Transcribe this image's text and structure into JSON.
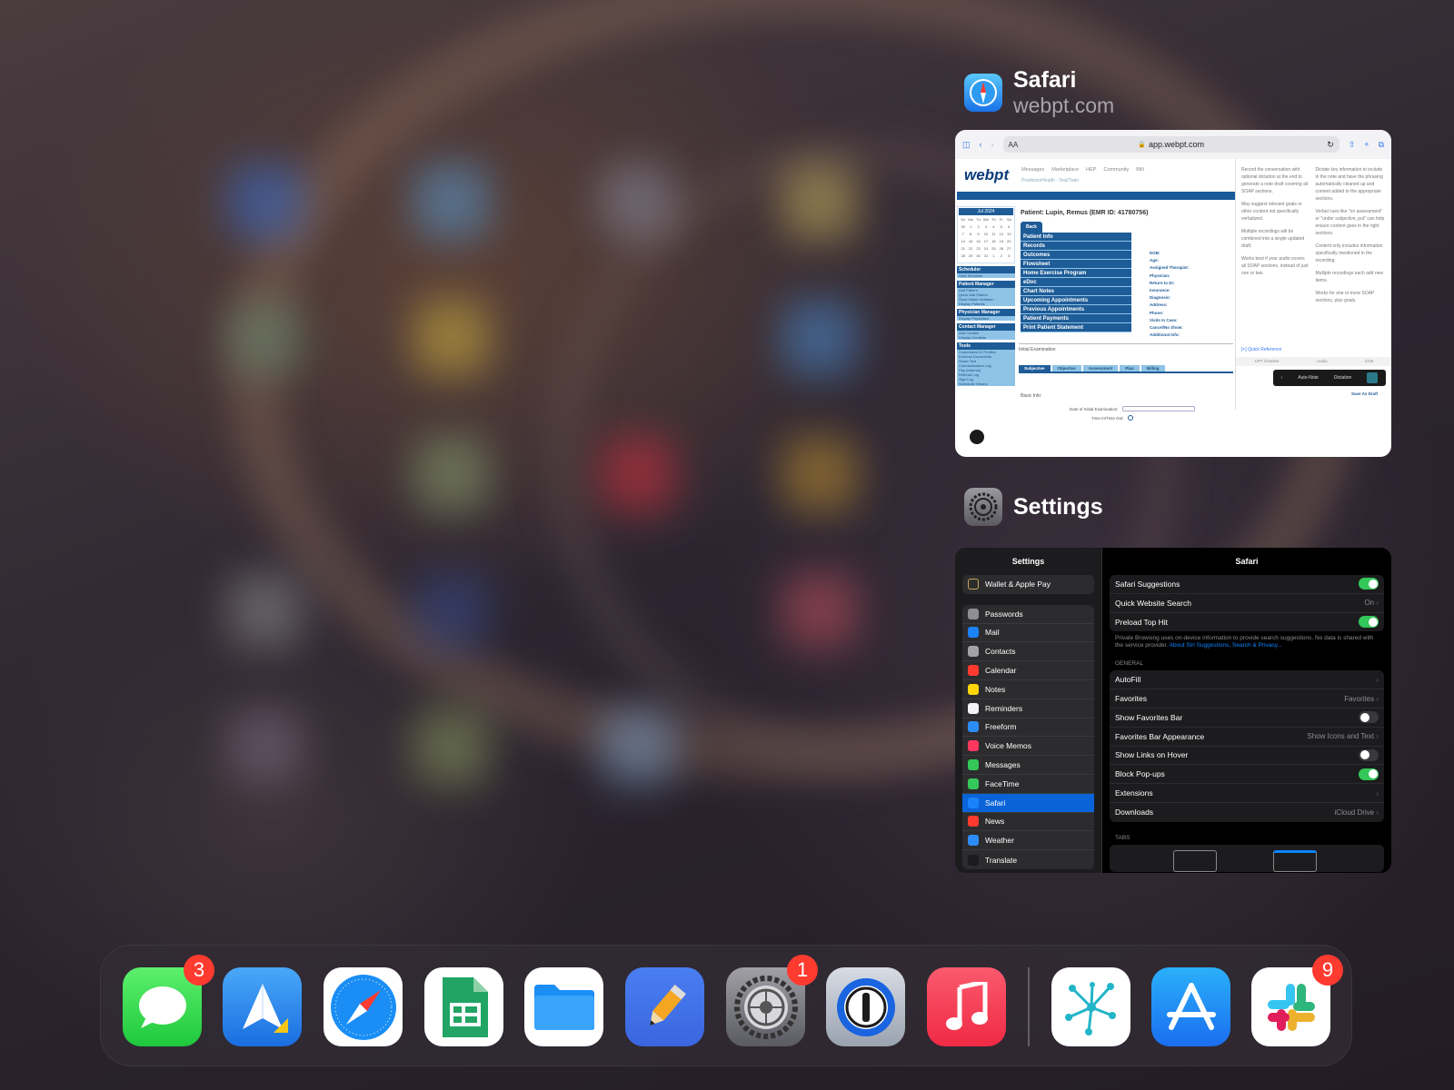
{
  "switcher": {
    "safari": {
      "name": "Safari",
      "subtitle": "webpt.com"
    },
    "settings": {
      "name": "Settings"
    }
  },
  "safari_snapshot": {
    "url": "app.webpt.com",
    "text_size": "AA",
    "logo": "webpt",
    "nav": [
      "Messages",
      "Marketplace",
      "HEP",
      "Community",
      "Billi"
    ],
    "clinic": "PredictionHealth - Test/Train",
    "patient_title": "Patient: Lupin, Remus (EMR ID: 41780756)",
    "back": "Back",
    "menu": [
      "Patient Info",
      "Records",
      "Outcomes",
      "Flowsheet",
      "Home Exercise Program",
      "eDoc",
      "Chart Notes",
      "Upcoming Appointments",
      "Previous Appointments",
      "Patient Payments",
      "Print Patient Statement"
    ],
    "patient_fields": [
      "DOB:",
      "Age:",
      "Assigned Therapist:",
      "Physician:",
      "Return to Dr:",
      "Insurance:",
      "Diagnosis:",
      "Address:",
      "Phone:",
      "Visits In Case:",
      "Cancel/No Show:",
      "Additional Info:"
    ],
    "initial_exam": "Initial Examination",
    "tabs": [
      "Subjective",
      "Objective",
      "Assessment",
      "Plan",
      "Billing"
    ],
    "basic_info": "Basic Info:",
    "date_label": "Date of Initial Examination:",
    "time_label": "Time In/Time Out:",
    "calendar_month": "Jul 2024",
    "calendar_days": [
      "Su",
      "Mo",
      "Tu",
      "We",
      "Th",
      "Fr",
      "Sa",
      "30",
      "1",
      "2",
      "3",
      "4",
      "5",
      "6",
      "7",
      "8",
      "9",
      "10",
      "11",
      "12",
      "13",
      "14",
      "15",
      "16",
      "17",
      "18",
      "19",
      "20",
      "21",
      "22",
      "23",
      "24",
      "25",
      "26",
      "27",
      "28",
      "29",
      "30",
      "31",
      "1",
      "2",
      "3"
    ],
    "left_sections": [
      {
        "h": "Scheduler",
        "items": [
          "View Schedule"
        ]
      },
      {
        "h": "Patient Manager",
        "items": [
          "Add Patient",
          "Quick Add Patient",
          "Send Intake Invitation",
          "Display Patients"
        ]
      },
      {
        "h": "Physician Manager",
        "items": [
          "Display Physicians"
        ]
      },
      {
        "h": "Contact Manager",
        "items": [
          "Add Contact",
          "Display Contacts"
        ]
      },
      {
        "h": "Tools",
        "items": [
          "Customized ID Profiles",
          "External Documents",
          "Smart Text",
          "Communication Log",
          "Pay (Internal)",
          "Referral Log",
          "Sign Log",
          "Scheduler History"
        ]
      }
    ],
    "side_col1": [
      "Record the conversation with optional dictation at the end to generate a note draft covering all SOAP sections.",
      "May suggest relevant goals or other content not specifically verbalized.",
      "Multiple recordings will be combined into a single updated draft.",
      "Works best if your audio covers all SOAP sections, instead of just one or two."
    ],
    "side_col2": [
      "Dictate key information to include in the note and have the phrasing automatically cleaned up and content added to the appropriate sections.",
      "Verbal cues like \"on assessment\" or \"under subjective, put\" can help ensure content goes in the right sections.",
      "Content only includes information specifically mentioned in the recording.",
      "Multiple recordings each add new items.",
      "Works for one or more SOAP sections, plus goals."
    ],
    "quick_ref": "[+] Quick Reference",
    "side_tabs": [
      "CPT Checker",
      "Audio",
      "Chat"
    ],
    "auto_note": "Auto-Note",
    "dictation": "Dictation",
    "save_draft": "Save As Draft"
  },
  "settings_snapshot": {
    "sidebar_title": "Settings",
    "top_item": "Wallet & Apple Pay",
    "items": [
      "Passwords",
      "Mail",
      "Contacts",
      "Calendar",
      "Notes",
      "Reminders",
      "Freeform",
      "Voice Memos",
      "Messages",
      "FaceTime",
      "Safari",
      "News",
      "Weather",
      "Translate"
    ],
    "item_colors": [
      "#8e8e93",
      "#1a82fb",
      "#a2a2a7",
      "#ff3b30",
      "#ffd60a",
      "#f2f2f7",
      "#2c8cf5",
      "#ff375f",
      "#34c759",
      "#34c759",
      "#1a82fb",
      "#ff3b30",
      "#2c8cf5",
      "#1c1c1e"
    ],
    "selected": "Safari",
    "detail_title": "Safari",
    "search_rows": [
      {
        "label": "Safari Suggestions",
        "toggle": true
      },
      {
        "label": "Quick Website Search",
        "value": "On"
      },
      {
        "label": "Preload Top Hit",
        "toggle": true
      }
    ],
    "note": "Private Browsing uses on-device information to provide search suggestions. No data is shared with the service provider.",
    "note_link": "About Siri Suggestions, Search & Privacy...",
    "general_header": "GENERAL",
    "general_rows": [
      {
        "label": "AutoFill",
        "value": ""
      },
      {
        "label": "Favorites",
        "value": "Favorites"
      },
      {
        "label": "Show Favorites Bar",
        "toggle": false
      },
      {
        "label": "Favorites Bar Appearance",
        "value": "Show Icons and Text"
      },
      {
        "label": "Show Links on Hover",
        "toggle": false
      },
      {
        "label": "Block Pop-ups",
        "toggle": true
      },
      {
        "label": "Extensions",
        "value": ""
      },
      {
        "label": "Downloads",
        "value": "iCloud Drive"
      }
    ],
    "tabs_header": "TABS"
  },
  "dock": {
    "apps": [
      {
        "name": "Messages",
        "badge": "3"
      },
      {
        "name": "Spark",
        "badge": ""
      },
      {
        "name": "Safari",
        "badge": ""
      },
      {
        "name": "Google Sheets",
        "badge": ""
      },
      {
        "name": "Files",
        "badge": ""
      },
      {
        "name": "Notability",
        "badge": ""
      },
      {
        "name": "Settings",
        "badge": "1"
      },
      {
        "name": "1Password",
        "badge": ""
      },
      {
        "name": "Music",
        "badge": ""
      },
      {
        "name": "Mind Map",
        "badge": ""
      },
      {
        "name": "App Store",
        "badge": ""
      },
      {
        "name": "Slack",
        "badge": "9"
      }
    ]
  }
}
